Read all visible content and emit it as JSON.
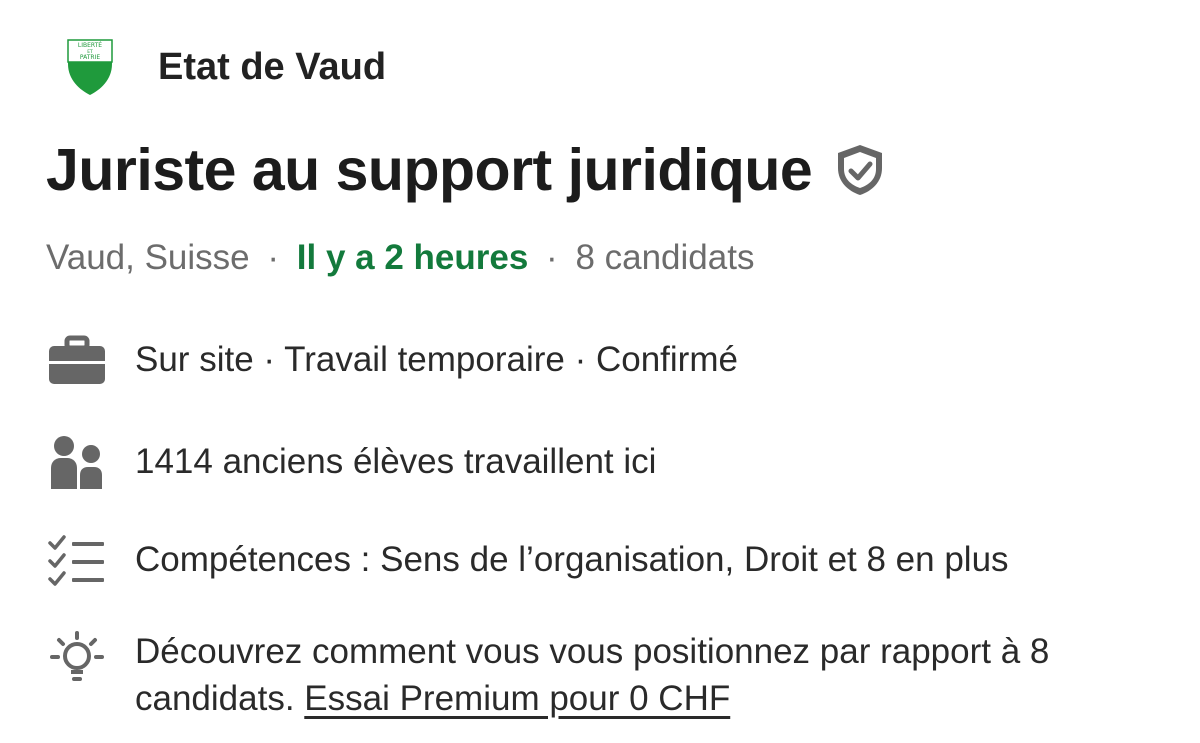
{
  "company": {
    "name": "Etat de Vaud",
    "logo_icon": "vaud-coat-of-arms-icon",
    "logo_text_top": "LIBERTÉ",
    "logo_text_mid": "ET",
    "logo_text_bottom": "PATRIE"
  },
  "job": {
    "title": "Juriste au support juridique",
    "verified_icon": "verified-shield-icon"
  },
  "meta": {
    "location": "Vaud, Suisse",
    "separator": "·",
    "posted": "Il y a 2 heures",
    "applicants": "8 candidats"
  },
  "insights": [
    {
      "icon": "briefcase-icon",
      "text": "Sur site · Travail temporaire · Confirmé"
    },
    {
      "icon": "people-icon",
      "text": "1414 anciens élèves travaillent ici"
    },
    {
      "icon": "checklist-icon",
      "text": "Compétences : Sens de l’organisation, Droit et 8 en plus"
    },
    {
      "icon": "lightbulb-icon",
      "text": "Découvrez comment vous vous positionnez par rapport à 8 candidats. ",
      "link": "Essai Premium pour 0 CHF"
    }
  ],
  "colors": {
    "posted_green": "#137a3c",
    "logo_green": "#1f9a3c",
    "icon_gray": "#666666",
    "meta_gray": "#6c6c6c"
  }
}
